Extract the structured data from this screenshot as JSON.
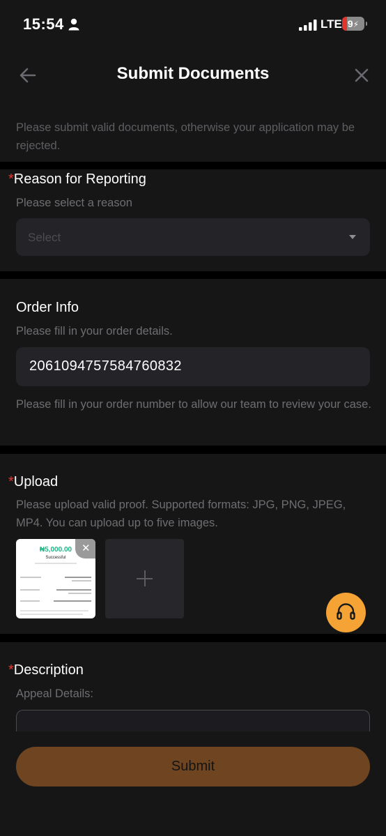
{
  "status_bar": {
    "time": "15:54",
    "network": "LTE",
    "battery": "9"
  },
  "header": {
    "title": "Submit Documents",
    "notice": "Please submit valid documents, otherwise your application may be rejected."
  },
  "reason": {
    "required_mark": "*",
    "title": "Reason for Reporting",
    "subtitle": "Please select a reason",
    "select_placeholder": "Select"
  },
  "order": {
    "title": "Order Info",
    "subtitle": "Please fill in your order details.",
    "value": "2061094757584760832",
    "hint": "Please fill in your order number to allow our team to review your case."
  },
  "upload": {
    "required_mark": "*",
    "title": "Upload",
    "subtitle": "Please upload valid proof. Supported formats: JPG, PNG, JPEG, MP4. You can upload up to five images.",
    "thumbnail": {
      "amount": "₦5,000.00",
      "status": "Successful"
    },
    "remove_label": "✕",
    "add_label": "+"
  },
  "description": {
    "required_mark": "*",
    "title": "Description",
    "subtitle": "Appeal Details:"
  },
  "submit_label": "Submit",
  "colors": {
    "background": "#161616",
    "field": "#232328",
    "required": "#e53935",
    "support_button": "#f5a334",
    "submit_button": "#6e4520"
  }
}
